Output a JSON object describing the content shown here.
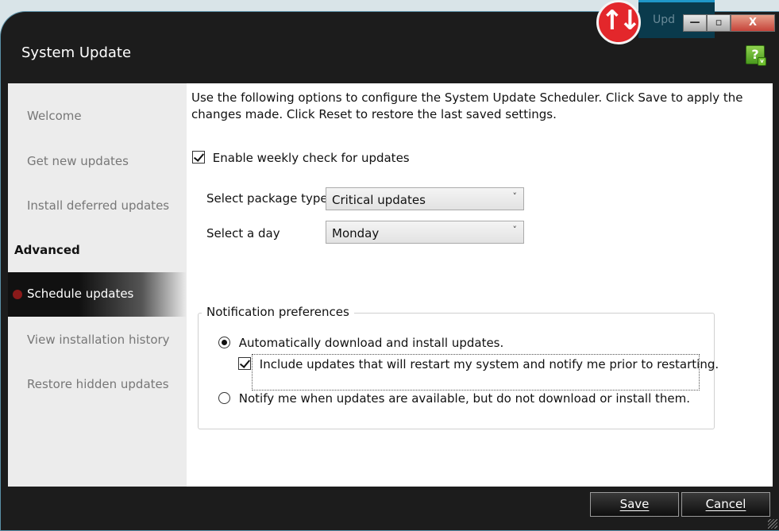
{
  "window": {
    "title": "System Update",
    "help_label": "?",
    "help_caret": "v",
    "update_tab_label": "Upd",
    "badge_glyph": "↑↓",
    "minimize_glyph": "—",
    "restore_glyph": "▫",
    "close_glyph": "X"
  },
  "sidebar": {
    "items": [
      "Welcome",
      "Get new updates",
      "Install deferred updates"
    ],
    "heading": "Advanced",
    "active_item": "Schedule updates",
    "items_after": [
      "View installation history",
      "Restore hidden updates"
    ]
  },
  "main": {
    "intro": "Use the following options to configure the System Update Scheduler. Click Save to apply the changes made. Click Reset to restore the last saved settings.",
    "weekly_check_label": "Enable weekly check for updates",
    "weekly_check_checked": true,
    "package_type_label": "Select package type:",
    "package_type_value": "Critical updates",
    "day_label": "Select a day",
    "day_value": "Monday",
    "notification": {
      "legend": "Notification preferences",
      "auto_label": "Automatically download and install updates.",
      "auto_selected": true,
      "include_restart_label": "Include updates that will restart my system and notify me prior to restarting.",
      "include_restart_checked": true,
      "notify_label": "Notify me when updates are available, but do not download or install them.",
      "notify_selected": false
    }
  },
  "footer": {
    "save_label": "Save",
    "cancel_label": "Cancel"
  },
  "colors": {
    "titlebar": "#1c1c1c",
    "accent_red": "#e3272b",
    "help_green": "#6fbf2f",
    "active_dot": "#8a1a1a"
  }
}
